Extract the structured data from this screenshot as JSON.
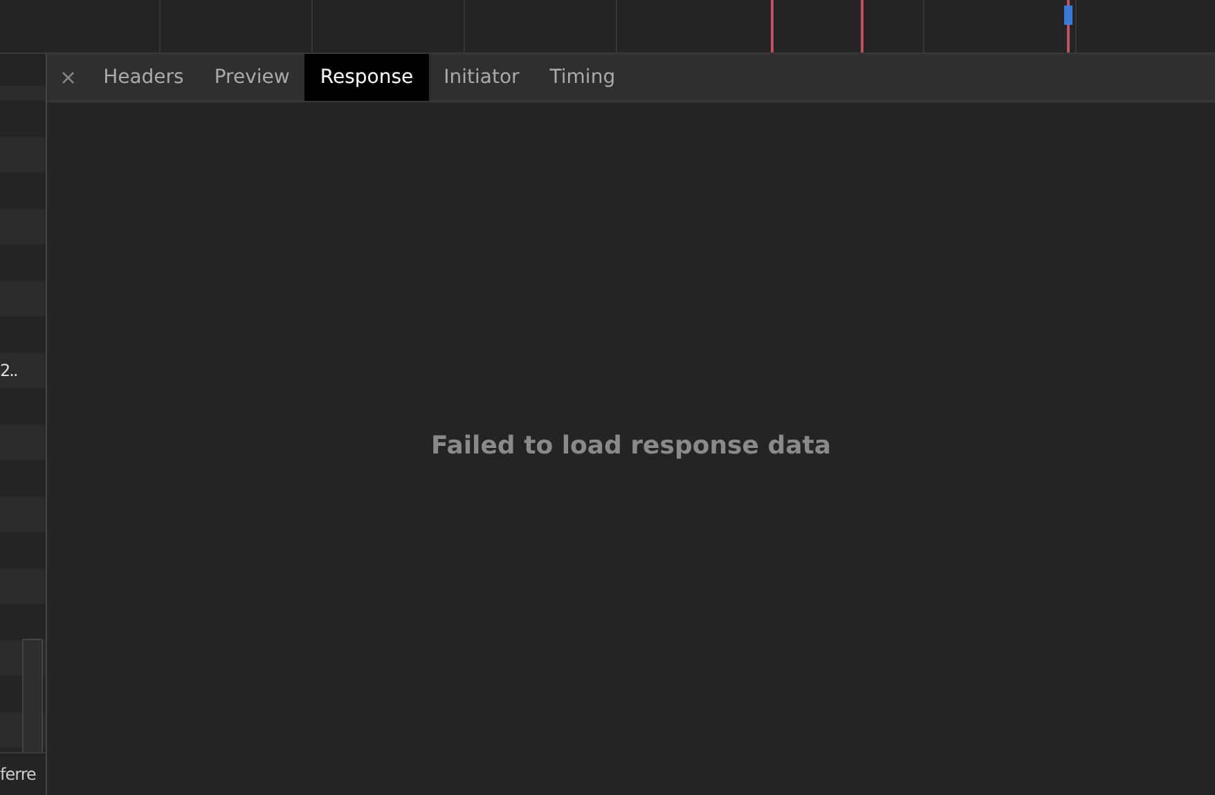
{
  "request_list": {
    "visible_text": "2..",
    "footer": "ferre"
  },
  "close_tab": "×",
  "tabs": [
    {
      "label": "Headers",
      "selected": false
    },
    {
      "label": "Preview",
      "selected": false
    },
    {
      "label": "Response",
      "selected": true
    },
    {
      "label": "Initiator",
      "selected": false
    },
    {
      "label": "Timing",
      "selected": false
    }
  ],
  "message": "Failed to load response data"
}
